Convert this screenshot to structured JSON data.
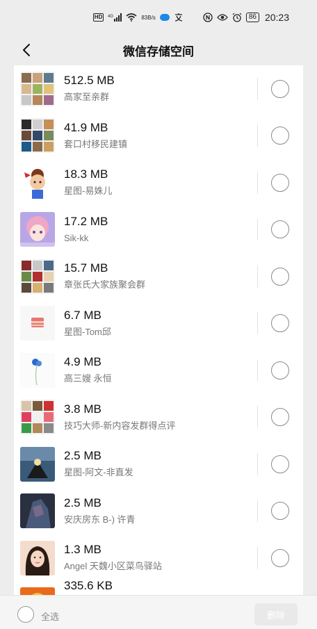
{
  "status_bar": {
    "hd_label": "HD",
    "signal_label": "4G",
    "speed_value": "83",
    "speed_unit": "B/s",
    "battery": "86",
    "time": "20:23"
  },
  "nav": {
    "title": "微信存储空间"
  },
  "items": [
    {
      "size": "512.5 MB",
      "name": "高家至亲群"
    },
    {
      "size": "41.9 MB",
      "name": "套口村移民建镇"
    },
    {
      "size": "18.3 MB",
      "name": "星图-易姝儿"
    },
    {
      "size": "17.2 MB",
      "name": "Sik-kk"
    },
    {
      "size": "15.7 MB",
      "name": "章张氏大家族聚会群"
    },
    {
      "size": "6.7 MB",
      "name": "星图-Tom邱"
    },
    {
      "size": "4.9 MB",
      "name": "高三嫂 永恒"
    },
    {
      "size": "3.8 MB",
      "name": "技巧大师-新内容发群得点评"
    },
    {
      "size": "2.5 MB",
      "name": "星图-阿文-非直发"
    },
    {
      "size": "2.5 MB",
      "name": "安庆房东 B-) 许青"
    },
    {
      "size": "1.3 MB",
      "name": "Angel 天魏小区菜鸟驿站"
    },
    {
      "size": "335.6 KB",
      "name": ""
    }
  ],
  "bottom": {
    "select_all": "全选",
    "delete_label": "删除"
  },
  "colors": {
    "page_bg": "#ededed",
    "list_bg": "#ffffff",
    "radio_border": "#8a8a8a",
    "delete_btn_bg": "#e9e9e9"
  }
}
